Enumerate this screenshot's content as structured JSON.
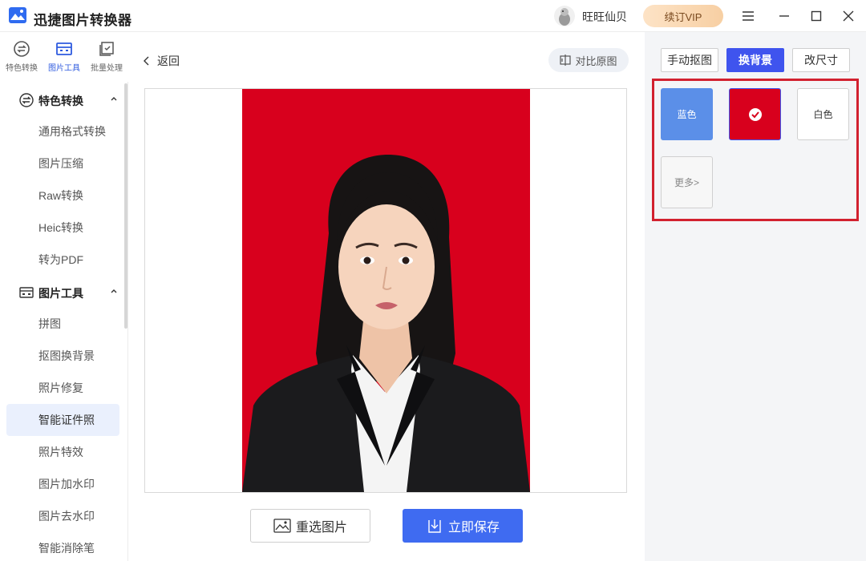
{
  "app": {
    "title": "迅捷图片转换器",
    "username": "旺旺仙贝",
    "vip_label": "续订VIP"
  },
  "left_tabs": [
    {
      "label": "特色转换"
    },
    {
      "label": "图片工具"
    },
    {
      "label": "批量处理"
    }
  ],
  "sidebar": {
    "groups": [
      {
        "title": "特色转换",
        "items": [
          "通用格式转换",
          "图片压缩",
          "Raw转换",
          "Heic转换",
          "转为PDF"
        ]
      },
      {
        "title": "图片工具",
        "items": [
          "拼图",
          "抠图换背景",
          "照片修复",
          "智能证件照",
          "照片特效",
          "图片加水印",
          "图片去水印",
          "智能消除笔"
        ]
      }
    ],
    "active_item": "智能证件照"
  },
  "center": {
    "back_label": "返回",
    "compare_label": "对比原图",
    "reselect_label": "重选图片",
    "save_label": "立即保存",
    "photo_background": "#d8001d"
  },
  "right_panel": {
    "tabs": [
      {
        "label": "手动抠图",
        "active": false
      },
      {
        "label": "换背景",
        "active": true
      },
      {
        "label": "改尺寸",
        "active": false
      }
    ],
    "swatches": [
      {
        "label": "蓝色",
        "color": "#5b8fe8"
      },
      {
        "label": "",
        "color": "#d8001d",
        "selected": true
      },
      {
        "label": "白色",
        "color": "#ffffff"
      },
      {
        "label": "更多>",
        "color": "#f7f7f7"
      }
    ]
  },
  "colors": {
    "accent": "#3f54ee",
    "save_button": "#3f6bf1",
    "highlight_border": "#d2212f"
  }
}
